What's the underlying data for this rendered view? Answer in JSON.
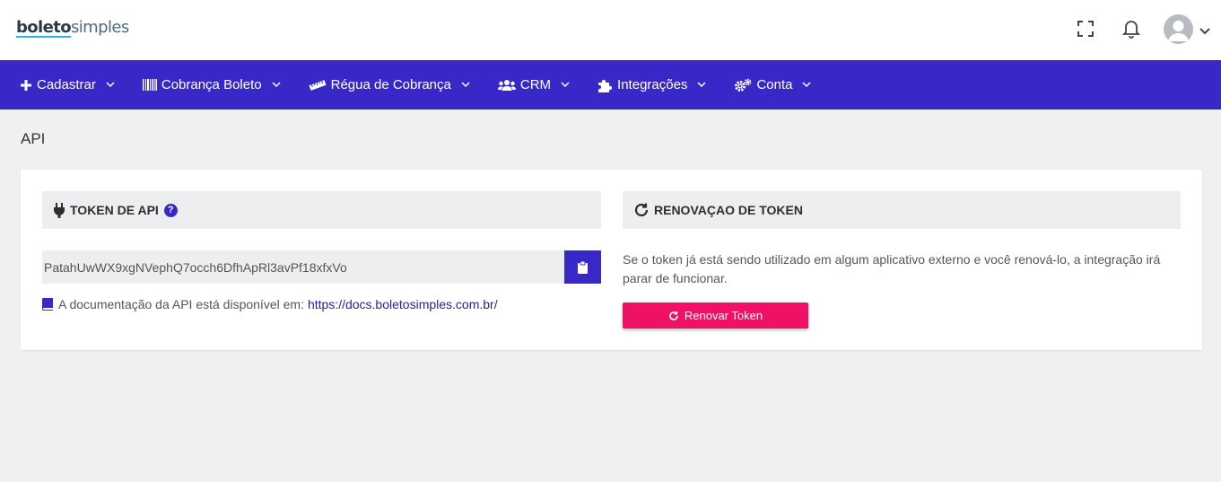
{
  "brand": {
    "bold": "boleto",
    "light": "simples"
  },
  "header": {
    "icons": [
      "fullscreen-icon",
      "bell-icon",
      "avatar",
      "chevron-down-icon"
    ]
  },
  "nav": {
    "items": [
      {
        "label": "Cadastrar",
        "icon": "plus-icon"
      },
      {
        "label": "Cobrança Boleto",
        "icon": "barcode-icon"
      },
      {
        "label": "Régua de Cobrança",
        "icon": "ruler-icon"
      },
      {
        "label": "CRM",
        "icon": "users-icon"
      },
      {
        "label": "Integrações",
        "icon": "puzzle-icon"
      },
      {
        "label": "Conta",
        "icon": "cogs-icon"
      }
    ],
    "color": "#3828c8"
  },
  "page": {
    "title": "API"
  },
  "token_panel": {
    "heading": "TOKEN DE API",
    "help": "?",
    "token_value": "PatahUwWX9xgNVephQ7occh6DfhApRl3avPf18xfxVo",
    "doc_text": "A documentação da API está disponível em:",
    "doc_link": "https://docs.boletosimples.com.br/"
  },
  "renew_panel": {
    "heading": "RENOVAÇAO DE TOKEN",
    "text": "Se o token já está sendo utilizado em algum aplicativo externo e você renová-lo, a integração irá parar de funcionar.",
    "button_label": "Renovar Token",
    "button_color": "#ee1166"
  }
}
